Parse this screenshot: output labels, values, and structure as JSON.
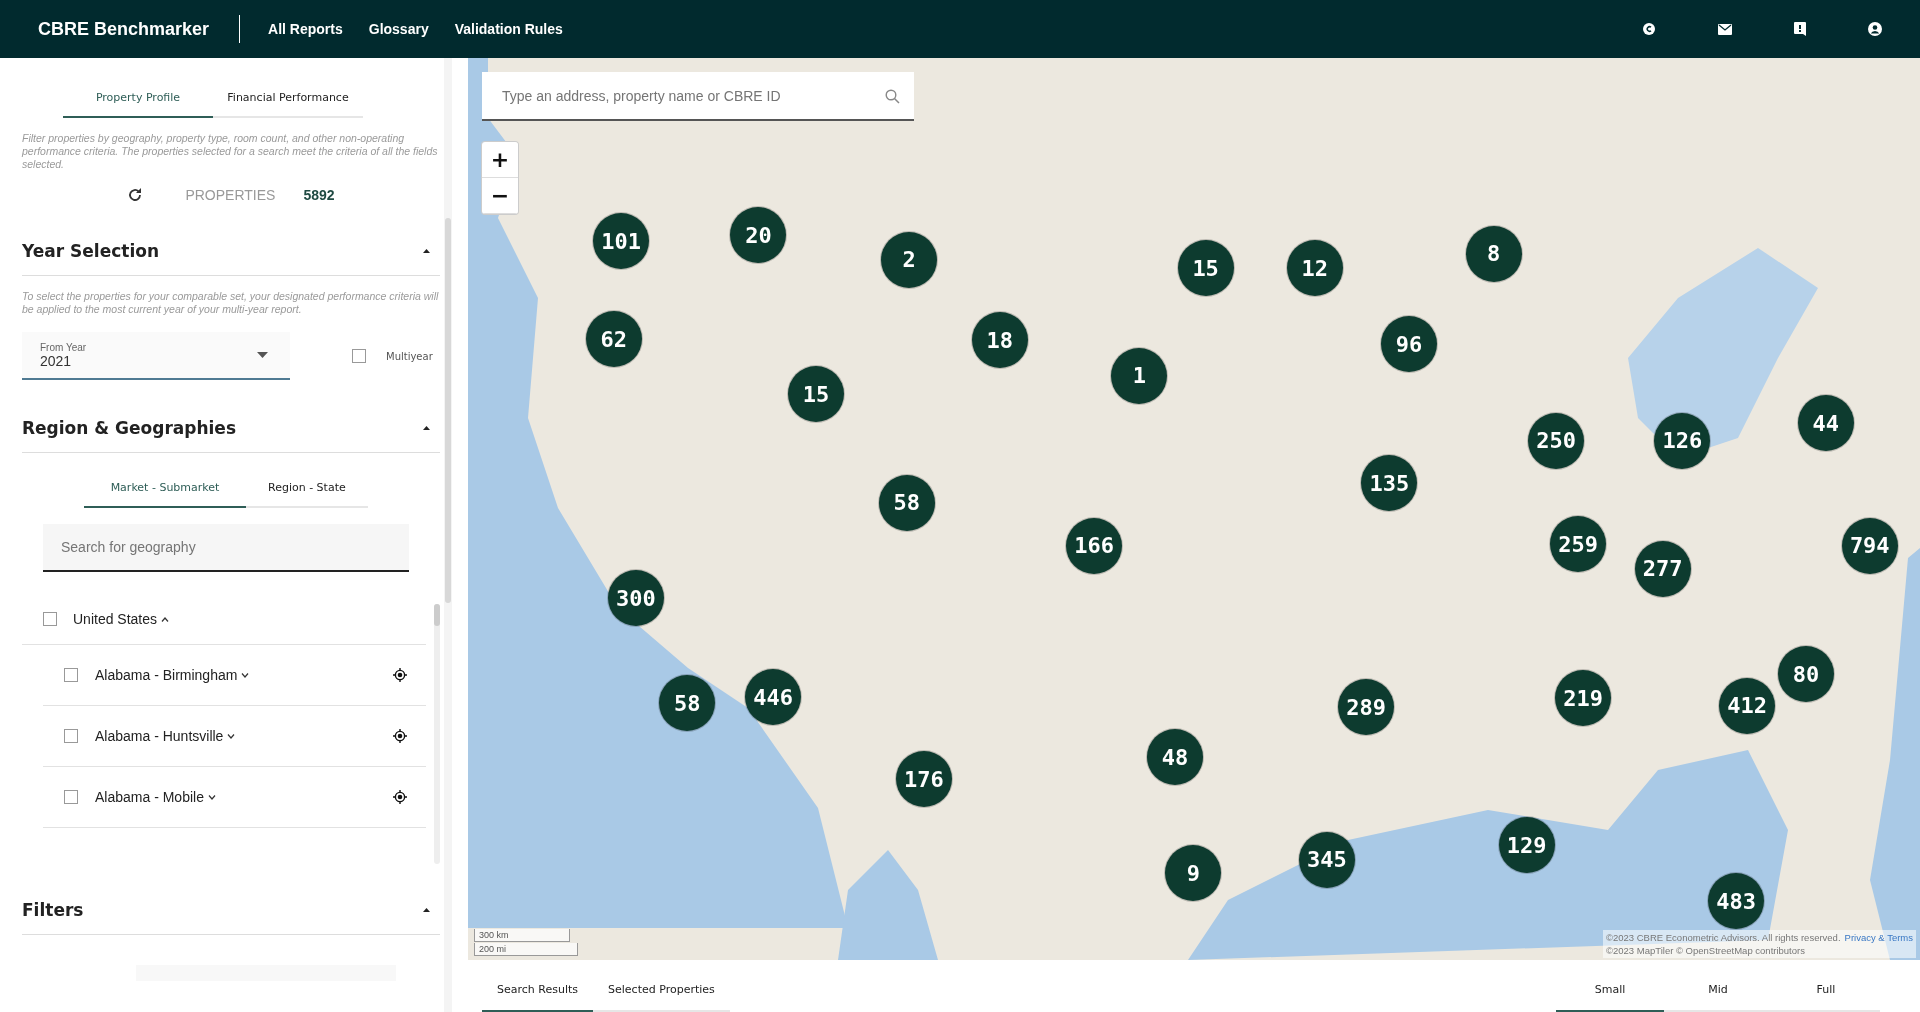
{
  "header": {
    "brand": "CBRE Benchmarker",
    "nav": [
      {
        "label": "All Reports"
      },
      {
        "label": "Glossary"
      },
      {
        "label": "Validation Rules"
      }
    ]
  },
  "sidebar": {
    "tabs": [
      {
        "label": "Property Profile",
        "selected": true
      },
      {
        "label": "Financial Performance",
        "selected": false
      }
    ],
    "intro": "Filter properties by geography, property type, room count, and other non-operating performance criteria. The properties selected for a search meet the criteria of all the fields selected.",
    "properties_label": "PROPERTIES",
    "properties_count": "5892",
    "year_section": {
      "title": "Year Selection",
      "expanded": true,
      "note": "To select the properties for your comparable set, your designated performance criteria will be applied to the most current year of your multi-year report.",
      "from_year": {
        "label": "From Year",
        "value": "2021"
      },
      "multiyear": {
        "label": "Multiyear",
        "checked": false
      }
    },
    "region_section": {
      "title": "Region & Geographies",
      "expanded": true,
      "tabs": [
        {
          "label": "Market - Submarket",
          "selected": true
        },
        {
          "label": "Region - State",
          "selected": false
        }
      ],
      "search": {
        "placeholder": "Search for geography"
      },
      "tree": [
        {
          "label": "United States",
          "checked": false,
          "expanded": true,
          "children": [
            {
              "label": "Alabama - Birmingham",
              "checked": false,
              "expanded": false
            },
            {
              "label": "Alabama - Huntsville",
              "checked": false,
              "expanded": false
            },
            {
              "label": "Alabama - Mobile",
              "checked": false,
              "expanded": false
            }
          ]
        }
      ]
    },
    "filters_section": {
      "title": "Filters",
      "expanded": true
    }
  },
  "map": {
    "search": {
      "placeholder": "Type an address, property name or CBRE ID"
    },
    "zoom_in": "+",
    "zoom_out": "−",
    "clusters": [
      {
        "count": "101"
      },
      {
        "count": "20"
      },
      {
        "count": "2"
      },
      {
        "count": "15"
      },
      {
        "count": "12"
      },
      {
        "count": "8"
      },
      {
        "count": "62"
      },
      {
        "count": "18"
      },
      {
        "count": "96"
      },
      {
        "count": "1"
      },
      {
        "count": "15"
      },
      {
        "count": "250"
      },
      {
        "count": "126"
      },
      {
        "count": "44"
      },
      {
        "count": "135"
      },
      {
        "count": "58"
      },
      {
        "count": "166"
      },
      {
        "count": "259"
      },
      {
        "count": "794"
      },
      {
        "count": "277"
      },
      {
        "count": "300"
      },
      {
        "count": "58"
      },
      {
        "count": "446"
      },
      {
        "count": "289"
      },
      {
        "count": "219"
      },
      {
        "count": "412"
      },
      {
        "count": "80"
      },
      {
        "count": "48"
      },
      {
        "count": "176"
      },
      {
        "count": "129"
      },
      {
        "count": "345"
      },
      {
        "count": "9"
      },
      {
        "count": "483"
      }
    ],
    "scale": [
      "300 km",
      "200 mi"
    ],
    "attribution": [
      "©2023 CBRE Econometric Advisors. All rights reserved.",
      "©2023 MapTiler © OpenStreetMap contributors"
    ],
    "attribution_link": "Privacy & Terms"
  },
  "results_bar": {
    "tabs": [
      {
        "label": "Search Results",
        "selected": true
      },
      {
        "label": "Selected Properties",
        "selected": false
      }
    ],
    "sizes": [
      {
        "label": "Small",
        "selected": true
      },
      {
        "label": "Mid",
        "selected": false
      },
      {
        "label": "Full",
        "selected": false
      }
    ]
  }
}
